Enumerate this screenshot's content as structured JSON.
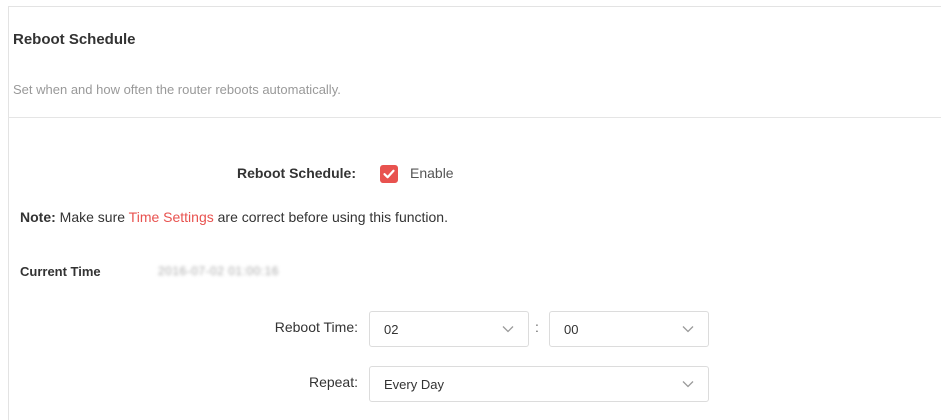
{
  "section": {
    "title": "Reboot Schedule",
    "description": "Set when and how often the router reboots automatically."
  },
  "schedule": {
    "label": "Reboot Schedule:",
    "checkbox_checked": true,
    "enable_label": "Enable"
  },
  "note": {
    "prefix": "Note:",
    "text_before": " Make sure ",
    "link": "Time Settings",
    "text_after": " are correct before using this function."
  },
  "current_time": {
    "label": "Current Time",
    "value": "2016-07-02 01:00:16"
  },
  "reboot_time": {
    "label": "Reboot Time:",
    "hour": "02",
    "separator": ":",
    "minute": "00"
  },
  "repeat": {
    "label": "Repeat:",
    "value": "Every Day"
  },
  "colors": {
    "accent": "#e8524f",
    "text": "#333333",
    "muted": "#999999"
  },
  "icons": {
    "checkbox": "checkmark-icon",
    "dropdown": "chevron-down-icon"
  }
}
